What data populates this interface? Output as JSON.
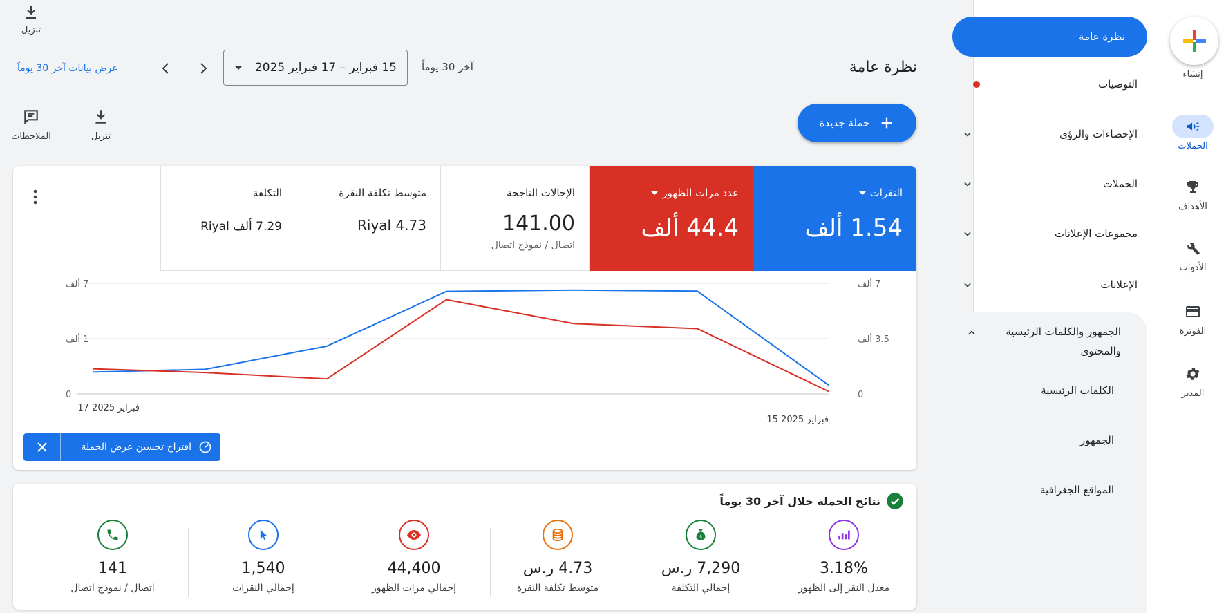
{
  "rail": {
    "create_label": "إنشاء",
    "items": [
      {
        "label": "الحملات",
        "icon": "megaphone-icon",
        "active": true
      },
      {
        "label": "الأهداف",
        "icon": "trophy-icon"
      },
      {
        "label": "الأدوات",
        "icon": "tools-icon"
      },
      {
        "label": "الفوترة",
        "icon": "credit-card-icon"
      },
      {
        "label": "المدير",
        "icon": "gear-icon"
      }
    ]
  },
  "nav": {
    "active": "نظرة عامة",
    "items": [
      {
        "label": "التوصيات"
      },
      {
        "label": "الإحصاءات والرؤى"
      },
      {
        "label": "الحملات"
      },
      {
        "label": "مجموعات الإعلانات"
      },
      {
        "label": "الإعلانات"
      }
    ],
    "expanded_line1": "الجمهور والكلمات الرئيسية",
    "expanded_line2": "والمحتوى",
    "sub_items": [
      "الكلمات الرئيسية",
      "الجمهور",
      "المواقع الجغرافية"
    ]
  },
  "header": {
    "download_label": "تنزيل",
    "page_title": "نظرة عامة",
    "date_preset": "آخر 30 يوماً",
    "date_range": "15 فبراير – 17 فبراير 2025",
    "view_link": "عرض بيانات آخر 30 يوماً",
    "new_campaign": "حملة جديدة",
    "toolbar_download": "تنزيل",
    "toolbar_notes": "الملاحظات"
  },
  "metrics": [
    {
      "label": "النقرات",
      "value": "1.54 ألف",
      "color": "#1a73e8"
    },
    {
      "label": "عدد مرات الظهور",
      "value": "44.4 ألف",
      "color": "#d93025"
    },
    {
      "label": "الإحالات الناجحة",
      "value": "141.00",
      "sub": "اتصال / نموذج اتصال"
    },
    {
      "label": "متوسط تكلفة النقرة",
      "value": "Riyal 4.73"
    },
    {
      "label": "التكلفة",
      "value": "7.29 ألف Riyal"
    }
  ],
  "chart_data": {
    "type": "line",
    "x": [
      "2025-02-15",
      "",
      "",
      "",
      "",
      "",
      "",
      "",
      "2025-02-17"
    ],
    "x_tick_labels": [
      "15 فبراير 2025",
      "17 فبراير 2025"
    ],
    "y_left_ticks": [
      "0",
      "1 ألف",
      "7 ألف"
    ],
    "y_right_ticks": [
      "0",
      "3.5 ألف",
      "7 ألف"
    ],
    "grid": true,
    "series": [
      {
        "name": "النقرات",
        "color": "#1a73e8",
        "values": [
          0.87,
          0.98,
          1.9,
          4.08,
          4.13,
          4.09,
          0.35
        ]
      },
      {
        "name": "عدد مرات الظهور",
        "color": "#d93025",
        "values": [
          1.0,
          0.85,
          0.6,
          3.75,
          2.8,
          2.6,
          0.1
        ]
      }
    ]
  },
  "suggestion": {
    "text": "اقتراح تحسين عرض الحملة"
  },
  "results": {
    "title": "نتائج الحملة خلال آخر 30 يوماً",
    "stats": [
      {
        "value": "3.18%",
        "label": "معدل النقر إلى الظهور",
        "icon": "bar-chart-icon",
        "color": "#9334e6"
      },
      {
        "value": "7,290 ر.س",
        "label": "إجمالي التكلفة",
        "icon": "money-bag-icon",
        "color": "#188038"
      },
      {
        "value": "4.73 ر.س",
        "label": "متوسط تكلفة النقرة",
        "icon": "coins-icon",
        "color": "#e8710a"
      },
      {
        "value": "44,400",
        "label": "إجمالي مرات الظهور",
        "icon": "eye-icon",
        "color": "#d93025"
      },
      {
        "value": "1,540",
        "label": "إجمالي النقرات",
        "icon": "cursor-icon",
        "color": "#1a73e8"
      },
      {
        "value": "141",
        "label": "اتصال / نموذج اتصال",
        "icon": "phone-icon",
        "color": "#188038"
      }
    ]
  }
}
